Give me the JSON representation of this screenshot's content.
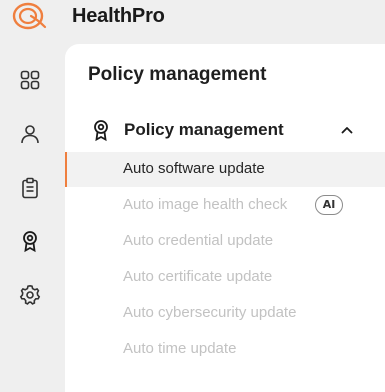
{
  "app": {
    "name": "HealthPro",
    "logo_icon": "healthpro-logo-icon",
    "brand_color": "#ef7f3f"
  },
  "rail": {
    "items": [
      {
        "icon": "dashboard-grid-icon"
      },
      {
        "icon": "user-icon"
      },
      {
        "icon": "clipboard-icon"
      },
      {
        "icon": "award-badge-icon"
      },
      {
        "icon": "gear-icon"
      }
    ]
  },
  "panel": {
    "title": "Policy management",
    "group": {
      "label": "Policy management",
      "icon": "award-badge-icon",
      "expanded": true,
      "chevron_icon": "chevron-up-icon"
    },
    "items": [
      {
        "label": "Auto software update",
        "active": true
      },
      {
        "label": "Auto image health check",
        "badge": "AI"
      },
      {
        "label": "Auto credential update"
      },
      {
        "label": "Auto certificate update"
      },
      {
        "label": "Auto cybersecurity update"
      },
      {
        "label": "Auto time update"
      }
    ]
  }
}
